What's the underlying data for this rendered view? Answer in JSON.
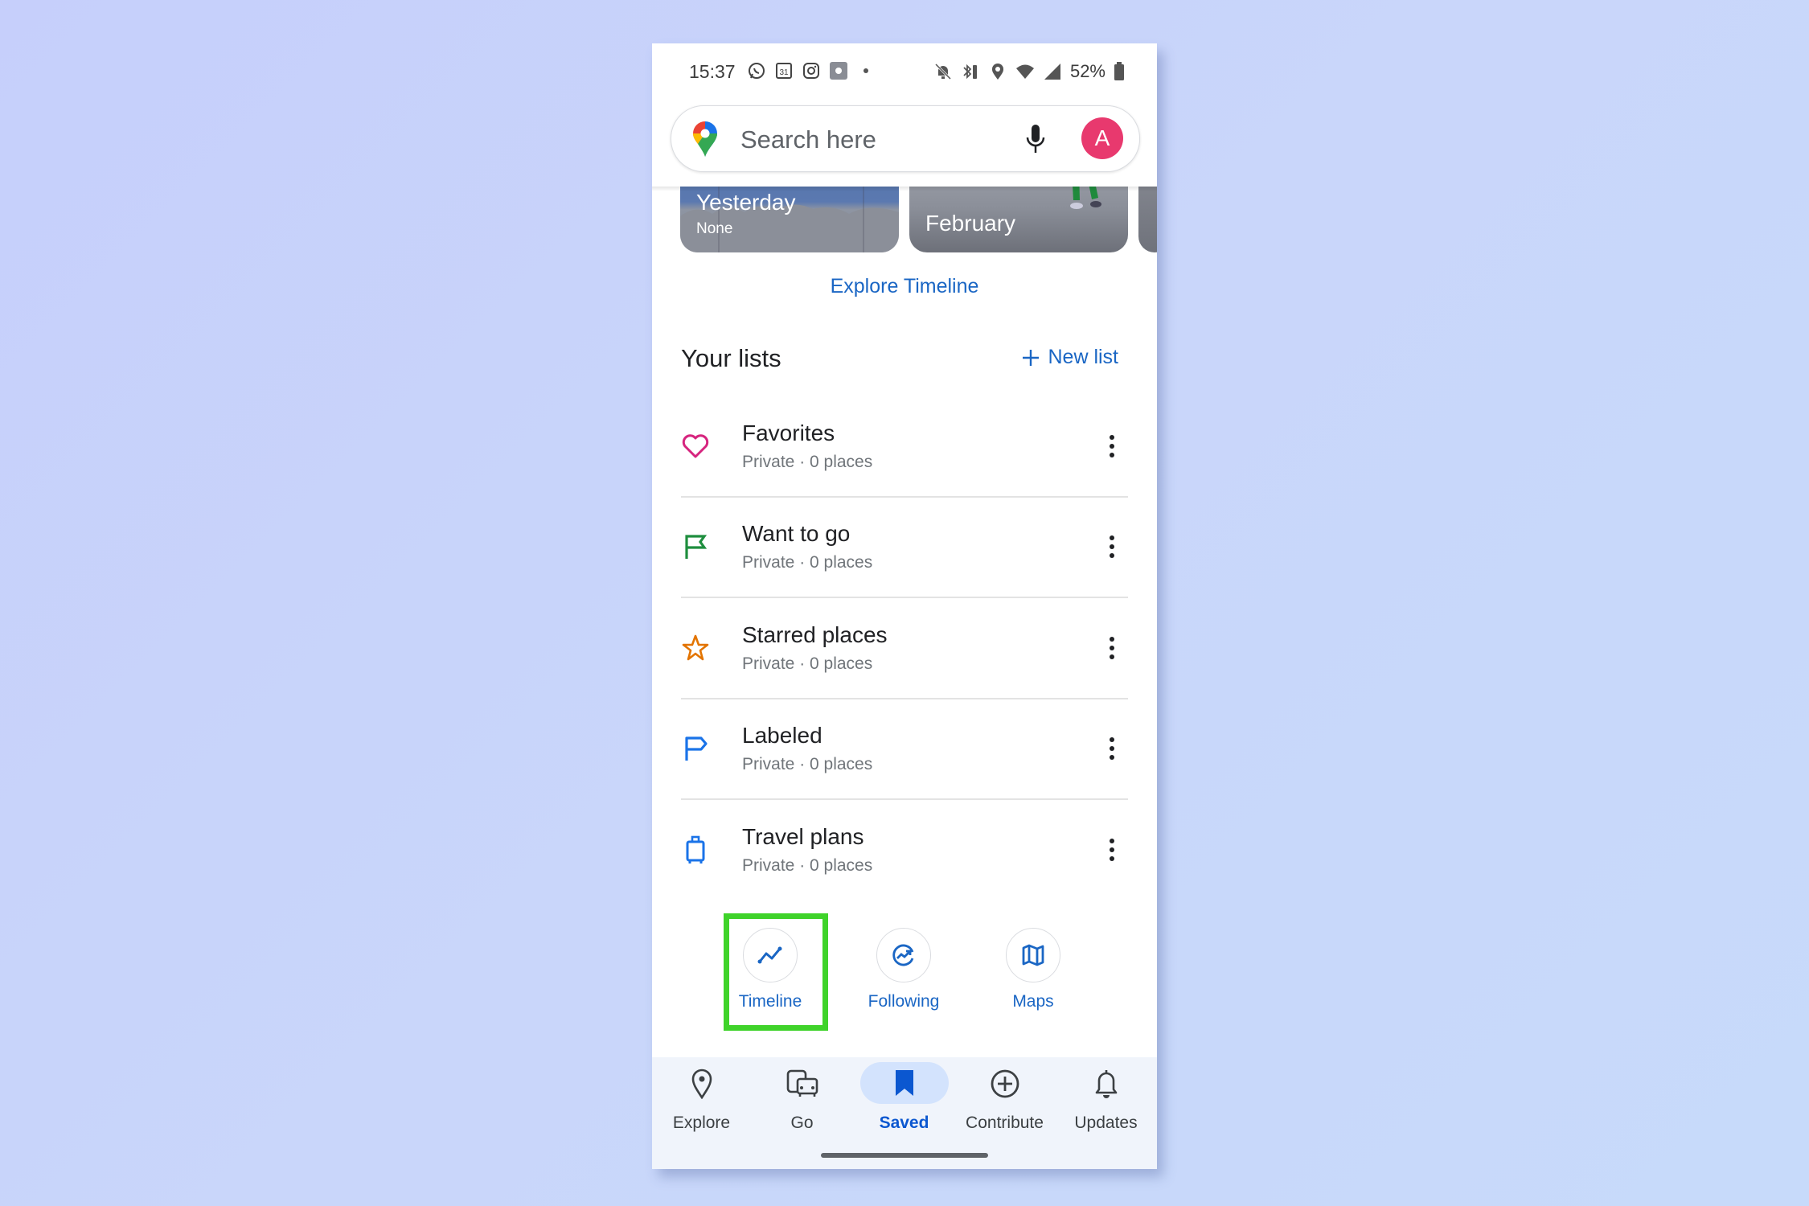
{
  "status_bar": {
    "time": "15:37",
    "left_icons": [
      "whatsapp-icon",
      "calendar-icon",
      "instagram-icon",
      "settings-app-icon",
      "notification-dot"
    ],
    "calendar_day": "31",
    "right_icons": [
      "bell-off-icon",
      "bluetooth-icon",
      "location-icon",
      "wifi-icon",
      "cell-signal-icon"
    ],
    "battery": "52%"
  },
  "search": {
    "placeholder": "Search here",
    "avatar_letter": "A",
    "avatar_color": "#e8396e"
  },
  "timeline_cards": [
    {
      "title": "Yesterday",
      "subtitle": "None"
    },
    {
      "title": "February",
      "subtitle": ""
    }
  ],
  "explore_timeline_label": "Explore Timeline",
  "lists": {
    "title": "Your lists",
    "new_list_label": "New list",
    "items": [
      {
        "name": "Favorites",
        "meta": "Private · 0 places",
        "icon": "heart-icon",
        "color": "#d6247e"
      },
      {
        "name": "Want to go",
        "meta": "Private · 0 places",
        "icon": "flag-icon",
        "color": "#1e8e3e"
      },
      {
        "name": "Starred places",
        "meta": "Private · 0 places",
        "icon": "star-icon",
        "color": "#e37400"
      },
      {
        "name": "Labeled",
        "meta": "Private · 0 places",
        "icon": "label-flag-icon",
        "color": "#1a73e8"
      },
      {
        "name": "Travel plans",
        "meta": "Private · 0 places",
        "icon": "suitcase-icon",
        "color": "#1a73e8"
      }
    ]
  },
  "quick_actions": [
    {
      "label": "Timeline",
      "icon": "timeline-icon",
      "highlighted": true
    },
    {
      "label": "Following",
      "icon": "following-icon",
      "highlighted": false
    },
    {
      "label": "Maps",
      "icon": "map-icon",
      "highlighted": false
    }
  ],
  "highlight_color": "#3fd32a",
  "bottom_nav": [
    {
      "label": "Explore",
      "icon": "location-pin-icon",
      "active": false
    },
    {
      "label": "Go",
      "icon": "transit-car-icon",
      "active": false
    },
    {
      "label": "Saved",
      "icon": "bookmark-icon",
      "active": true
    },
    {
      "label": "Contribute",
      "icon": "add-circle-icon",
      "active": false
    },
    {
      "label": "Updates",
      "icon": "bell-icon",
      "active": false
    }
  ],
  "accent_color": "#1a66c4"
}
